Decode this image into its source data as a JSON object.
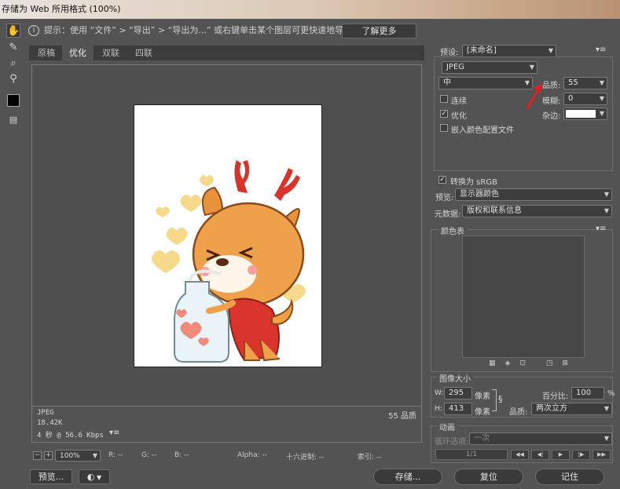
{
  "window": {
    "title": "存储为 Web 所用格式 (100%)"
  },
  "hint": {
    "text": "提示：使用 “文件” > “导出” > “导出为...” 或右键单击某个图层可更快速地导出资源",
    "learn_more": "了解更多"
  },
  "tabs": [
    {
      "label": "原稿"
    },
    {
      "label": "优化"
    },
    {
      "label": "双联"
    },
    {
      "label": "四联"
    }
  ],
  "preview": {
    "format": "JPEG",
    "size": "18.42K",
    "speed": "4 秒 @ 56.6 Kbps",
    "quality_note": "55 品质"
  },
  "status": {
    "zoom": "100%",
    "r": "R: --",
    "g": "G: --",
    "b": "B: --",
    "alpha": "Alpha: --",
    "hex": "十六进制: --",
    "index": "索引: --"
  },
  "settings": {
    "preset_label": "预设:",
    "preset_value": "[未命名]",
    "format_value": "JPEG",
    "quality_level": "中",
    "quality_label": "品质:",
    "quality_value": "55",
    "blur_label": "模糊:",
    "blur_value": "0",
    "matte_label": "杂边:",
    "matte_color": "#ffffff",
    "progressive": "连续",
    "optimized": "优化",
    "embed_profile": "嵌入颜色配置文件",
    "convert_srgb": "转换为 sRGB",
    "preview_label": "预览:",
    "preview_value": "显示器颜色",
    "metadata_label": "元数据:",
    "metadata_value": "版权和联系信息"
  },
  "color_table": {
    "title": "颜色表"
  },
  "image_size": {
    "title": "图像大小",
    "w_label": "W:",
    "w_value": "295",
    "h_label": "H:",
    "h_value": "413",
    "unit": "像素",
    "percent_label": "百分比:",
    "percent_value": "100",
    "percent_unit": "%",
    "quality_label": "品质:",
    "quality_value": "两次立方"
  },
  "animation": {
    "title": "动画",
    "loop_label": "循环选项:",
    "loop_value": "一次",
    "frame": "1/1"
  },
  "buttons": {
    "preview": "预览...",
    "save": "存储...",
    "reset": "复位",
    "remember": "记住"
  },
  "colors": {
    "accent_arrow": "#e02020"
  }
}
